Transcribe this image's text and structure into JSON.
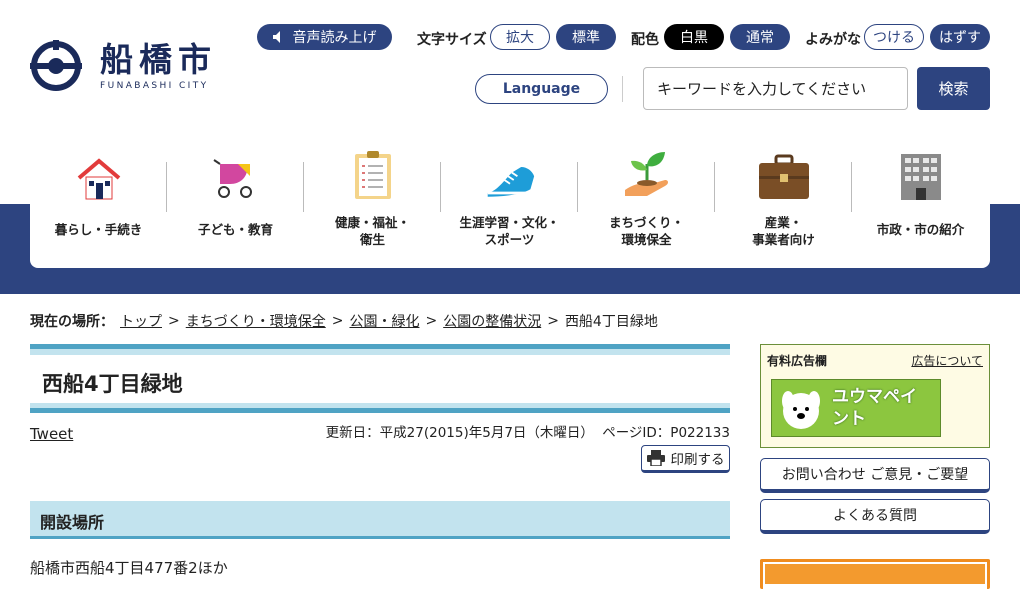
{
  "header": {
    "logo": {
      "name_jp": "船橋市",
      "name_en": "FUNABASHI CITY"
    },
    "voice_button": "音声読み上げ",
    "font_size": {
      "label": "文字サイズ",
      "enlarge": "拡大",
      "standard": "標準"
    },
    "color_scheme": {
      "label": "配色",
      "black_white": "白黒",
      "normal": "通常"
    },
    "furigana": {
      "label": "よみがな",
      "on": "つける",
      "off": "はずす"
    },
    "language_button": "Language",
    "search": {
      "placeholder": "キーワードを入力してください",
      "button": "検索"
    }
  },
  "nav": {
    "items": [
      {
        "label": "暮らし・手続き",
        "icon": "house-icon"
      },
      {
        "label": "子ども・教育",
        "icon": "stroller-icon"
      },
      {
        "label": "健康・福祉・\n衛生",
        "icon": "clipboard-icon"
      },
      {
        "label": "生涯学習・文化・\nスポーツ",
        "icon": "sneaker-icon"
      },
      {
        "label": "まちづくり・\n環境保全",
        "icon": "sprout-icon"
      },
      {
        "label": "産業・\n事業者向け",
        "icon": "briefcase-icon"
      },
      {
        "label": "市政・市の紹介",
        "icon": "building-icon"
      }
    ]
  },
  "breadcrumb": {
    "label": "現在の場所：",
    "items": [
      "トップ",
      "まちづくり・環境保全",
      "公園・緑化",
      "公園の整備状況"
    ],
    "current": "西船4丁目緑地",
    "separator": ">"
  },
  "page": {
    "title": "西船4丁目緑地",
    "tweet": "Tweet",
    "updated": "更新日：平成27(2015)年5月7日（木曜日）",
    "page_id": "ページID：P022133",
    "print_button": "印刷する",
    "section_heading": "開設場所",
    "section_body": "船橋市西船4丁目477番2ほか"
  },
  "sidebar": {
    "ad_header": "有料広告欄",
    "ad_about": "広告について",
    "ad_banner_text": "ユウマペイント",
    "contact_button": "お問い合わせ ご意見・ご要望",
    "faq_button": "よくある質問"
  },
  "colors": {
    "brand_navy": "#2d4480",
    "accent_blue": "#4fa3c4",
    "light_blue": "#c2e3ee",
    "orange": "#f08c1e"
  }
}
